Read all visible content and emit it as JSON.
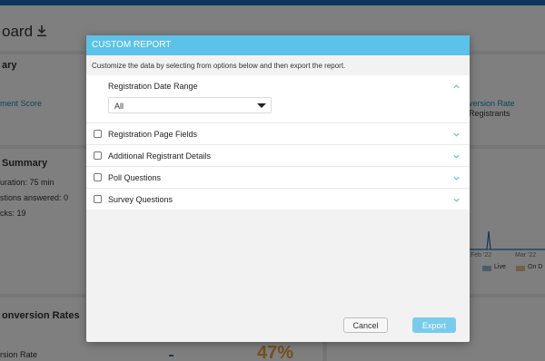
{
  "background": {
    "title": "oard",
    "download_icon": "download-icon",
    "cards": {
      "summary_heading": "ary",
      "engagement_score": "ment Score",
      "conversion_rate": "version Rate",
      "registrants": "Registrants",
      "live_summary_heading": "Summary",
      "duration": "uration: 75 min",
      "questions_answered": "stions answered: 0",
      "clicks": "cks: 19",
      "chart_tick_feb": "Feb '22",
      "chart_tick_mar": "Mar '22",
      "legend_live": "Live",
      "legend_ondemand": "On D",
      "conversion_rates_heading": "onversion Rates",
      "conversion_rate_label": "rsion Rate",
      "conversion_percent": "47%"
    }
  },
  "modal": {
    "title": "CUSTOM REPORT",
    "description": "Customize the data by selecting from options below and then export the report.",
    "date_range": {
      "label": "Registration Date Range",
      "selected": "All"
    },
    "sections": [
      {
        "label": "Registration Page Fields",
        "checked": false
      },
      {
        "label": "Additional Registrant Details",
        "checked": false
      },
      {
        "label": "Poll Questions",
        "checked": false
      },
      {
        "label": "Survey Questions",
        "checked": false
      }
    ],
    "buttons": {
      "cancel": "Cancel",
      "export": "Export"
    }
  },
  "colors": {
    "header_blue": "#5bc2ea",
    "export_button": "#79cbec",
    "topbar": "#1f6fb8",
    "accent_orange": "#e6a23c"
  }
}
